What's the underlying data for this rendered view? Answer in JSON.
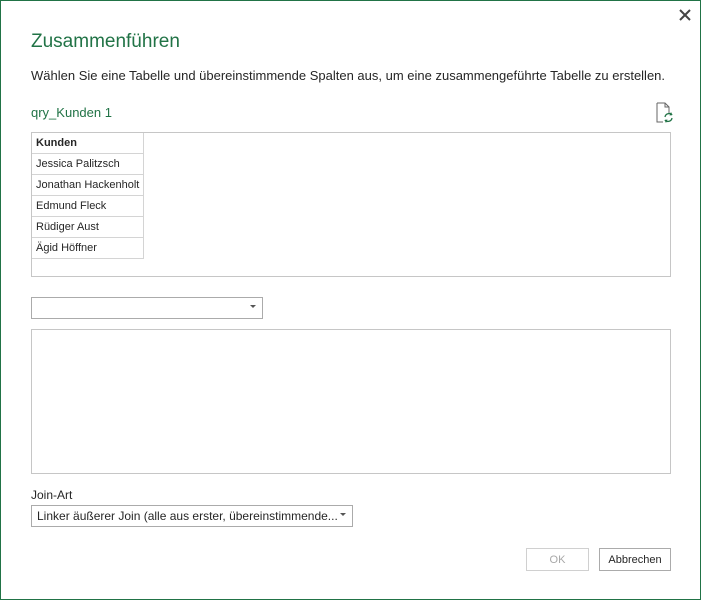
{
  "dialog": {
    "title": "Zusammenführen",
    "subtitle": "Wählen Sie eine Tabelle und übereinstimmende Spalten aus, um eine zusammengeführte Tabelle zu erstellen.",
    "query_name": "qry_Kunden 1",
    "close_icon": "close-icon",
    "refresh_icon": "refresh-icon"
  },
  "preview_table": {
    "header": "Kunden",
    "rows": [
      "Jessica Palitzsch",
      "Jonathan Hackenholt",
      "Edmund Fleck",
      "Rüdiger Aust",
      "Ägid Höffner"
    ]
  },
  "second_table_select": {
    "value": ""
  },
  "join": {
    "label": "Join-Art",
    "value": "Linker äußerer Join (alle aus erster, übereinstimmende..."
  },
  "buttons": {
    "ok": "OK",
    "cancel": "Abbrechen"
  },
  "colors": {
    "accent": "#217346"
  }
}
